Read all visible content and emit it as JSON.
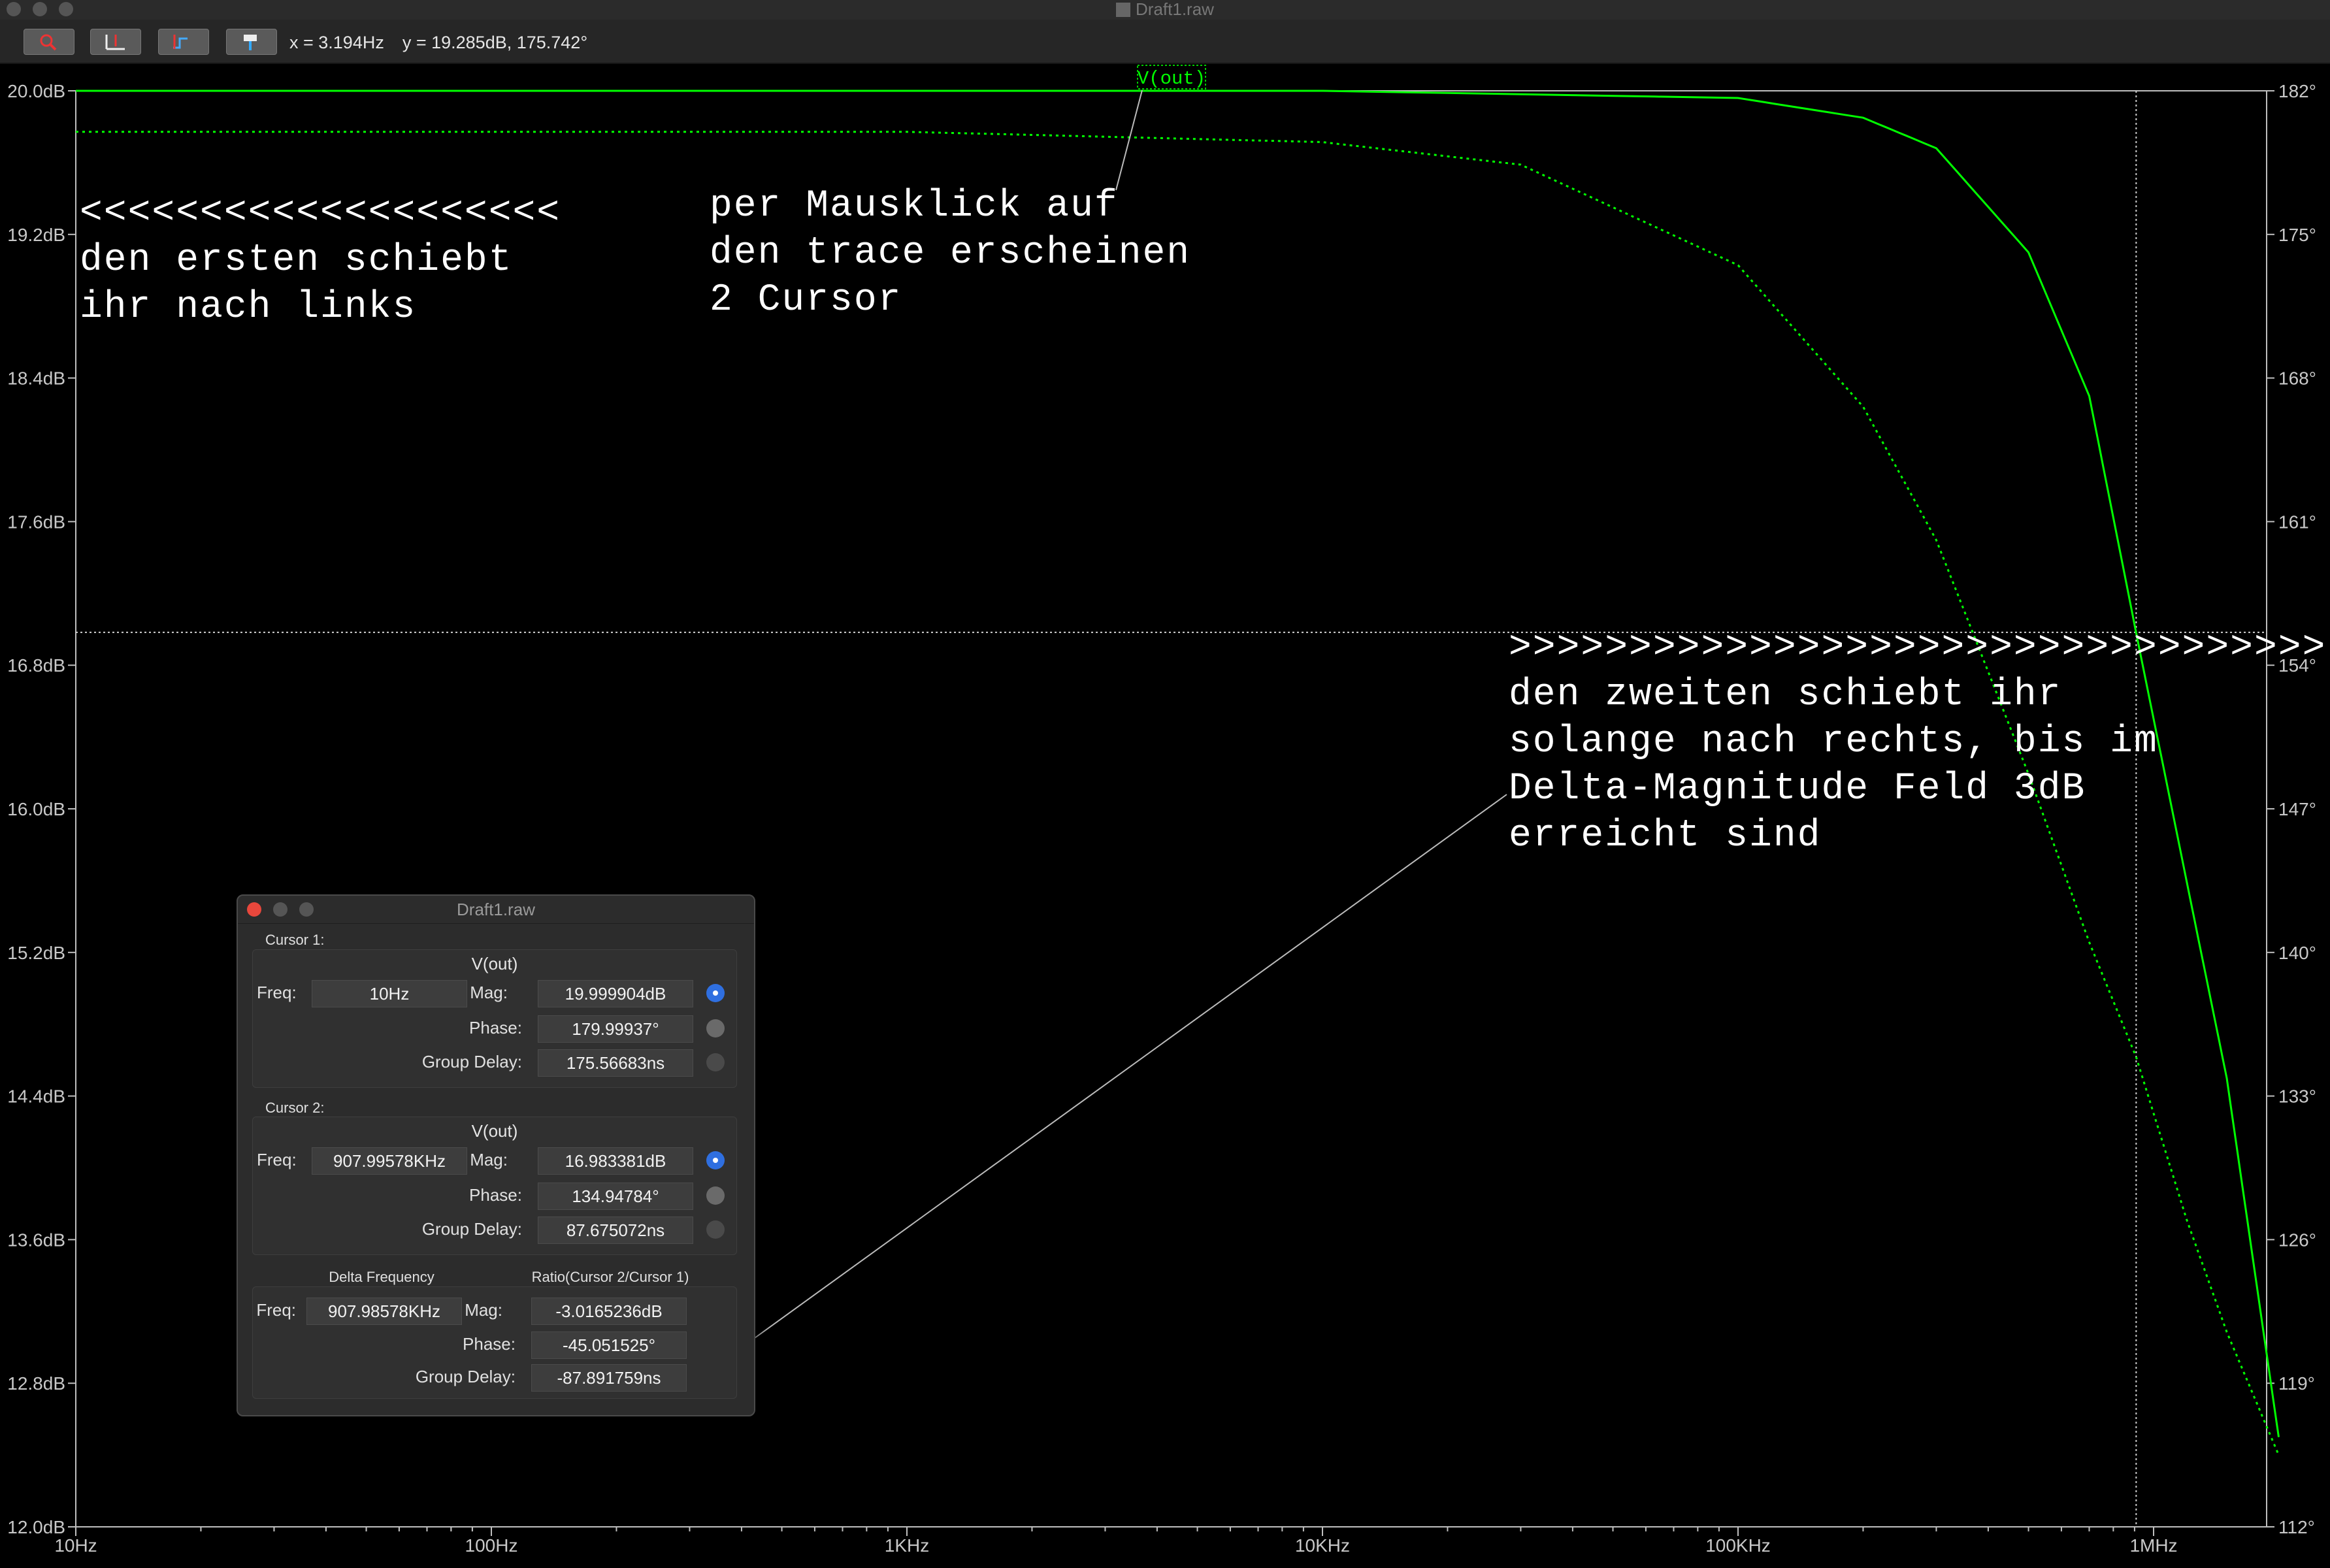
{
  "window": {
    "title": "Draft1.raw"
  },
  "toolbar": {
    "buttons": [
      "zoom-icon",
      "autorange-icon",
      "pan-icon",
      "probe-icon"
    ],
    "readout_x": "x = 3.194Hz",
    "readout_y": "y = 19.285dB, 175.742°"
  },
  "plot": {
    "trace_label": "V(out)",
    "trace_color": "#00ff00",
    "left_ticks": [
      "20.0dB",
      "19.2dB",
      "18.4dB",
      "17.6dB",
      "16.8dB",
      "16.0dB",
      "15.2dB",
      "14.4dB",
      "13.6dB",
      "12.8dB",
      "12.0dB"
    ],
    "right_ticks": [
      "182°",
      "175°",
      "168°",
      "161°",
      "154°",
      "147°",
      "140°",
      "133°",
      "126°",
      "119°",
      "112°"
    ],
    "bottom_ticks": [
      "10Hz",
      "100Hz",
      "1KHz",
      "10KHz",
      "100KHz",
      "1MHz"
    ]
  },
  "chart_data": {
    "type": "line",
    "x_scale": "log",
    "xlim": [
      10,
      2000000
    ],
    "ylim_left": [
      12.0,
      20.0
    ],
    "ylim_right": [
      112,
      182
    ],
    "series": [
      {
        "name": "V(out)",
        "style": "solid",
        "axis": "left",
        "x": [
          10,
          100,
          1000,
          10000,
          100000,
          200000,
          300000,
          500000,
          700000,
          907995.78,
          1200000,
          1500000,
          2000000
        ],
        "y": [
          20.0,
          20.0,
          20.0,
          20.0,
          19.96,
          19.85,
          19.68,
          19.1,
          18.3,
          16.98,
          15.6,
          14.5,
          12.5
        ]
      },
      {
        "name": "V(out)",
        "style": "dotted",
        "axis": "right",
        "x": [
          10,
          1000,
          10000,
          30000,
          100000,
          200000,
          300000,
          500000,
          700000,
          907995.78,
          1200000,
          1500000,
          2000000
        ],
        "y": [
          180,
          180,
          179.5,
          178.4,
          173.5,
          166.6,
          160.1,
          148.7,
          140.5,
          134.9,
          127.0,
          121.5,
          115.5
        ]
      }
    ],
    "cursor_freq": 907995.78,
    "cursor_mag_db": 16.983381
  },
  "annotations": {
    "left": "<<<<<<<<<<<<<<<<<<<<\nden ersten schiebt\nihr nach links",
    "middle": "per Mausklick auf\nden trace erscheinen\n2 Cursor",
    "right": ">>>>>>>>>>>>>>>>>>>>>>>>>>>>>>>>>>\nden zweiten schiebt ihr\nsolange nach rechts, bis im\nDelta-Magnitude Feld 3dB\nerreicht sind"
  },
  "dialog": {
    "title": "Draft1.raw",
    "cursor1": {
      "label": "Cursor 1:",
      "trace": "V(out)",
      "freq_label": "Freq:",
      "freq": "10Hz",
      "mag_label": "Mag:",
      "mag": "19.999904dB",
      "phase_label": "Phase:",
      "phase": "179.99937°",
      "gd_label": "Group Delay:",
      "gd": "175.56683ns"
    },
    "cursor2": {
      "label": "Cursor 2:",
      "trace": "V(out)",
      "freq_label": "Freq:",
      "freq": "907.99578KHz",
      "mag_label": "Mag:",
      "mag": "16.983381dB",
      "phase_label": "Phase:",
      "phase": "134.94784°",
      "gd_label": "Group Delay:",
      "gd": "87.675072ns"
    },
    "delta": {
      "freq_header": "Delta Frequency",
      "ratio_header": "Ratio(Cursor 2/Cursor 1)",
      "freq_label": "Freq:",
      "freq": "907.98578KHz",
      "mag_label": "Mag:",
      "mag": "-3.0165236dB",
      "phase_label": "Phase:",
      "phase": "-45.051525°",
      "gd_label": "Group Delay:",
      "gd": "-87.891759ns"
    }
  }
}
